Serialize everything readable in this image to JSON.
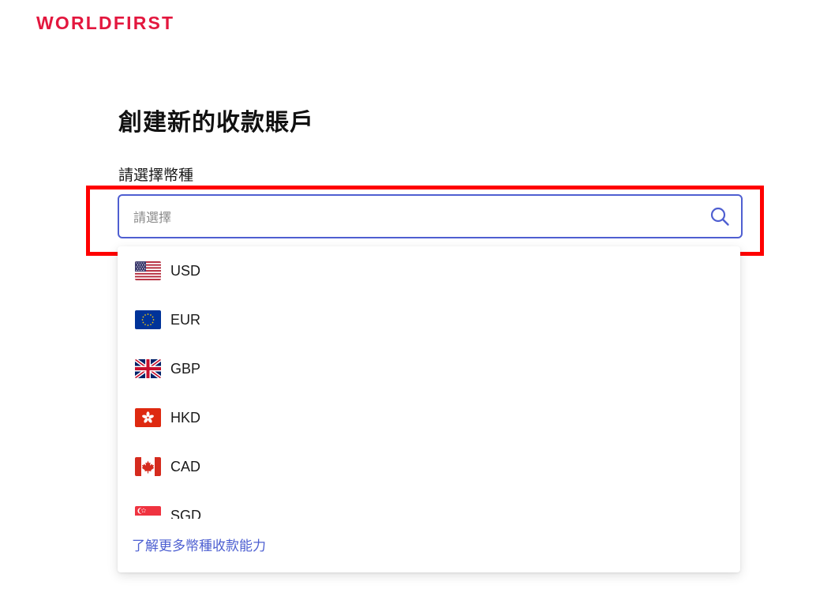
{
  "header": {
    "logo": "WORLDFIRST"
  },
  "page": {
    "title": "創建新的收款賬戶",
    "currency_label": "請選擇幣種"
  },
  "select": {
    "placeholder": "請選擇",
    "value": ""
  },
  "icons": {
    "search": "search-icon"
  },
  "colors": {
    "brand": "#e3173e",
    "accent": "#4f5fd1",
    "link": "#4d5fd1",
    "highlight": "#ff0000"
  },
  "currencies": [
    {
      "code": "USD",
      "flag": "us-flag-icon"
    },
    {
      "code": "EUR",
      "flag": "eu-flag-icon"
    },
    {
      "code": "GBP",
      "flag": "gb-flag-icon"
    },
    {
      "code": "HKD",
      "flag": "hk-flag-icon"
    },
    {
      "code": "CAD",
      "flag": "ca-flag-icon"
    },
    {
      "code": "SGD",
      "flag": "sg-flag-icon"
    }
  ],
  "footer": {
    "more_link": "了解更多幣種收款能力"
  }
}
